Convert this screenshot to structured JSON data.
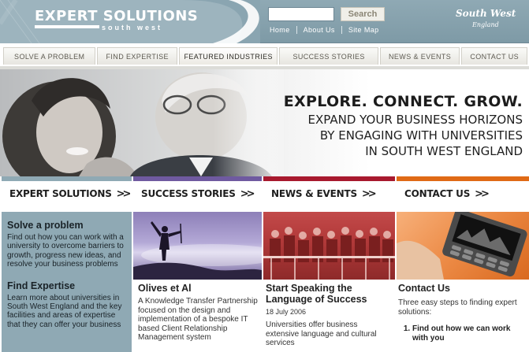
{
  "header": {
    "logo_title": "EXPERT SOLUTIONS",
    "logo_subtitle": "south west",
    "search_button": "Search",
    "search_value": "",
    "links": [
      "Home",
      "About Us",
      "Site Map"
    ],
    "brand_right": "South West",
    "brand_right_sub": "England"
  },
  "nav": {
    "items": [
      {
        "label": "SOLVE A PROBLEM"
      },
      {
        "label": "FIND EXPERTISE"
      },
      {
        "label": "FEATURED INDUSTRIES"
      },
      {
        "label": "SUCCESS STORIES"
      },
      {
        "label": "NEWS & EVENTS"
      },
      {
        "label": "CONTACT US"
      }
    ]
  },
  "hero": {
    "headline": "EXPLORE. CONNECT. GROW.",
    "lines": [
      "EXPAND YOUR BUSINESS HORIZONS",
      "BY ENGAGING WITH UNIVERSITIES",
      "IN SOUTH WEST ENGLAND"
    ]
  },
  "sections": [
    {
      "label": "EXPERT SOLUTIONS",
      "color": "#8fa9b4"
    },
    {
      "label": "SUCCESS STORIES",
      "color": "#6f5aa0"
    },
    {
      "label": "NEWS & EVENTS",
      "color": "#a8192e"
    },
    {
      "label": "CONTACT US",
      "color": "#e06a16"
    }
  ],
  "left_panel": {
    "solve_heading": "Solve a problem",
    "solve_text": "Find out how you can work with a university to overcome barriers to growth, progress new ideas, and resolve your business problems",
    "expertise_heading": "Find Expertise",
    "expertise_text": "Learn more about universities in South West England and the key facilities and areas of expertise that they can offer your business"
  },
  "success": {
    "heading": "Olives et Al",
    "text": "A Knowledge Transfer Partnership focused on the design and implementation of a bespoke IT based Client Relationship Management system"
  },
  "news": {
    "heading": "Start Speaking the Language of Success",
    "date": "18 July 2006",
    "text": "Universities offer business extensive language and cultural services"
  },
  "contact": {
    "heading": "Contact Us",
    "intro": "Three easy steps to finding expert solutions:",
    "steps": [
      "Find out how we can work with you"
    ]
  },
  "colors": {
    "header_bg": "#8fa9b4",
    "expert_bar": "#8fa9b4",
    "success_bar": "#6f5aa0",
    "news_bar": "#a8192e",
    "contact_bar": "#e06a16"
  }
}
